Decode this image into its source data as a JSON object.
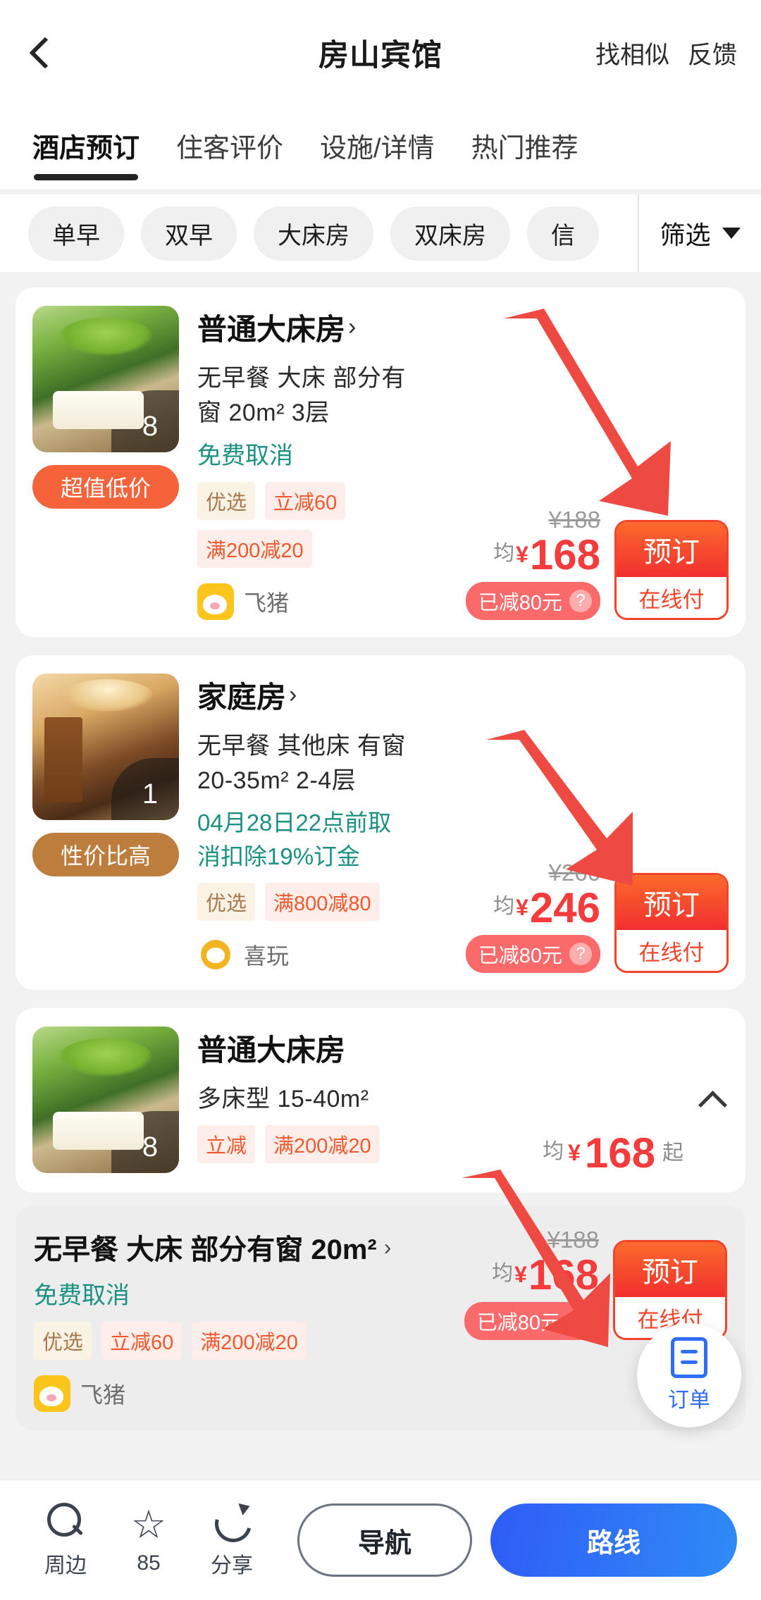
{
  "header": {
    "back_icon": "back-chevron-icon",
    "title": "房山宾馆",
    "actions": [
      "找相似",
      "反馈"
    ]
  },
  "tabs": [
    {
      "label": "酒店预订",
      "active": true
    },
    {
      "label": "住客评价",
      "active": false
    },
    {
      "label": "设施/详情",
      "active": false
    },
    {
      "label": "热门推荐",
      "active": false
    }
  ],
  "filterbar": {
    "chips": [
      "单早",
      "双早",
      "大床房",
      "双床房",
      "信"
    ],
    "filter_label": "筛选",
    "caret_icon": "chevron-down-icon"
  },
  "rooms": [
    {
      "title": "普通大床房",
      "chevron": "›",
      "meta": "无早餐  大床  部分有窗  20m²  3层",
      "cancel": "免费取消",
      "tags": [
        "优选",
        "立减60",
        "满200减20"
      ],
      "vendor": "飞猪",
      "vendor_logo": "fliggy-logo-icon",
      "image_count": "8",
      "badge": "超值低价",
      "badge_style": "orange",
      "price_old": "¥188",
      "price_prefix": "均",
      "price_currency": "¥",
      "price": "168",
      "cut": "已减80元",
      "help_icon": "question-mark-icon",
      "book_label": "预订",
      "pay_label": "在线付"
    },
    {
      "title": "家庭房",
      "chevron": "›",
      "meta": "无早餐  其他床  有窗  20-35m²  2-4层",
      "cancel": "04月28日22点前取消扣除19%订金",
      "tags": [
        "优选",
        "满800减80"
      ],
      "vendor": "喜玩",
      "vendor_logo": "xiwan-logo-icon",
      "image_count": "1",
      "badge": "性价比高",
      "badge_style": "brown",
      "price_old": "¥266",
      "price_prefix": "均",
      "price_currency": "¥",
      "price": "246",
      "cut": "已减80元",
      "help_icon": "question-mark-icon",
      "book_label": "预订",
      "pay_label": "在线付"
    }
  ],
  "group_room": {
    "title": "普通大床房",
    "meta": "多床型  15-40m²",
    "tags": [
      "立减",
      "满200减20"
    ],
    "image_count": "8",
    "price_prefix": "均",
    "price_currency": "¥",
    "price": "168",
    "price_suffix": "起",
    "collapse_icon": "chevron-up-icon"
  },
  "expanded_rate": {
    "title": "无早餐 大床 部分有窗 20m²",
    "chevron": "›",
    "cancel": "免费取消",
    "tags": [
      "优选",
      "立减60",
      "满200减20"
    ],
    "vendor": "飞猪",
    "vendor_logo": "fliggy-logo-icon",
    "price_old": "¥188",
    "price_prefix": "均",
    "price_currency": "¥",
    "price": "168",
    "cut": "已减80元",
    "book_label": "预订",
    "pay_label": "在线付"
  },
  "fab": {
    "icon": "order-list-icon",
    "label": "订单"
  },
  "bottombar": {
    "items": [
      {
        "icon": "search-icon",
        "label": "周边"
      },
      {
        "icon": "star-icon",
        "label": "85"
      },
      {
        "icon": "share-icon",
        "label": "分享"
      }
    ],
    "nav_button": "导航",
    "route_button": "路线"
  },
  "colors": {
    "accent_red": "#f53b3b",
    "accent_orange": "#f4633a",
    "teal": "#1a9181",
    "blue": "#2f5cf6",
    "arrow_red": "#ef4a42"
  },
  "annotations": [
    {
      "name": "arrow-to-book-button-1"
    },
    {
      "name": "arrow-to-book-button-2"
    },
    {
      "name": "arrow-to-book-button-3"
    }
  ]
}
